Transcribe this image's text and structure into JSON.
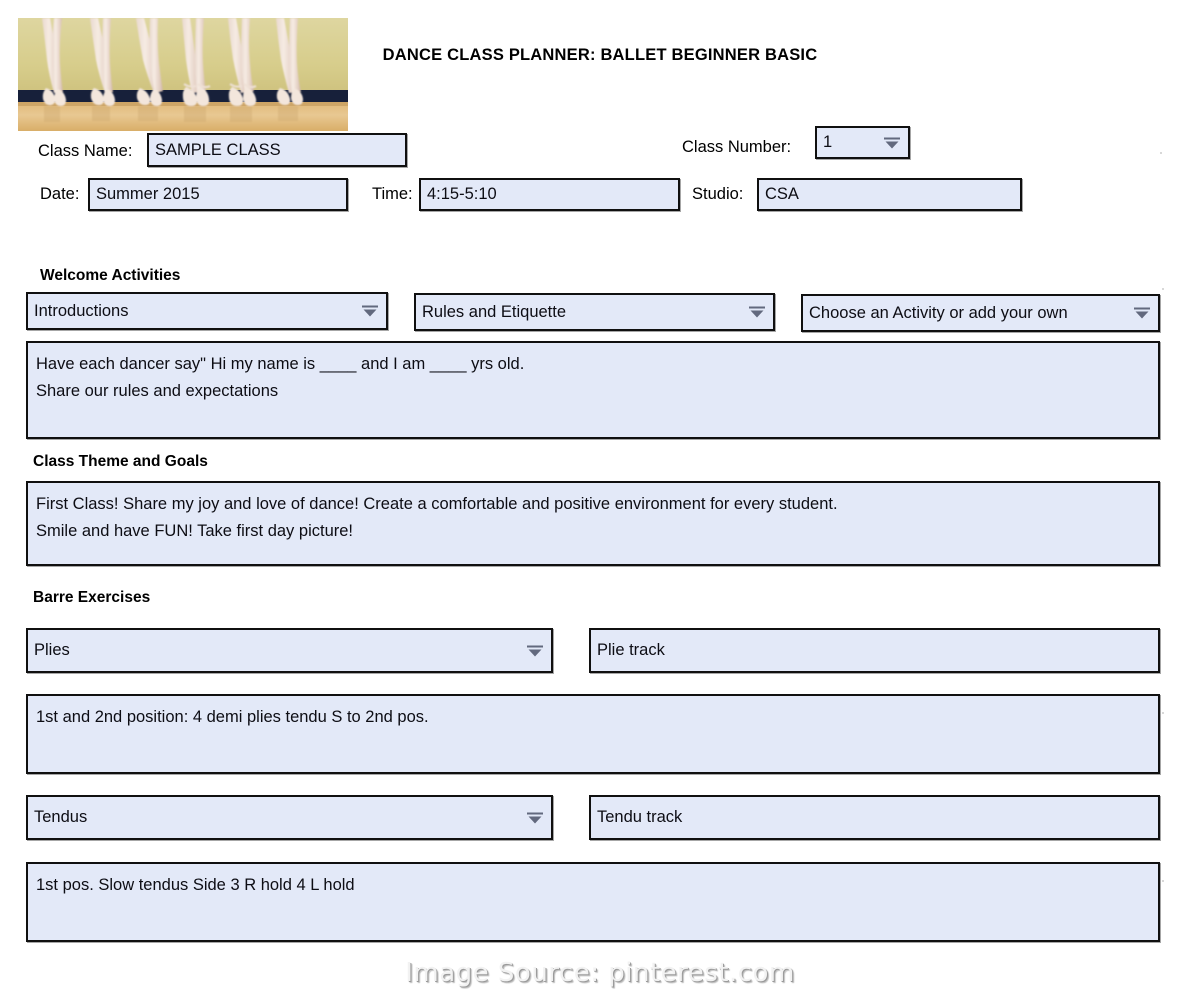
{
  "document": {
    "title": "DANCE CLASS PLANNER: BALLET BEGINNER BASIC",
    "watermark": "Image Source: pinterest.com",
    "photo_alt": "ballet-dancers-en-pointe-photo"
  },
  "header_fields": {
    "class_name": {
      "label": "Class Name:",
      "value": "SAMPLE CLASS"
    },
    "class_number": {
      "label": "Class Number:",
      "value": "1"
    },
    "date": {
      "label": "Date:",
      "value": "Summer 2015"
    },
    "time": {
      "label": "Time:",
      "value": "4:15-5:10"
    },
    "studio": {
      "label": "Studio:",
      "value": "CSA"
    }
  },
  "sections": {
    "welcome": {
      "heading": "Welcome Activities",
      "dropdowns": [
        {
          "value": "Introductions"
        },
        {
          "value": "Rules and Etiquette"
        },
        {
          "value": "Choose an Activity or add your own"
        }
      ],
      "notes": "Have each dancer say\" Hi my name is ____ and I am ____ yrs old.\nShare our rules and expectations"
    },
    "theme": {
      "heading": "Class Theme and Goals",
      "notes": "First Class! Share my joy and love of dance! Create a comfortable and positive environment for every student.\nSmile and have FUN!   Take first day picture!"
    },
    "barre": {
      "heading": "Barre Exercises",
      "exercises": [
        {
          "name": "Plies",
          "track": "Plie track",
          "notes": "1st  and 2nd position: 4 demi plies tendu S to 2nd pos."
        },
        {
          "name": "Tendus",
          "track": "Tendu track",
          "notes": "1st pos. Slow tendus Side 3 R hold 4 L hold"
        }
      ]
    }
  },
  "colors": {
    "field_fill": "#e3e9f8",
    "field_border": "#101010",
    "page_background": "#ffffff",
    "watermark_text": "#f2f2f2"
  },
  "icons": {
    "dropdown_arrow": "chevron-down-icon"
  }
}
